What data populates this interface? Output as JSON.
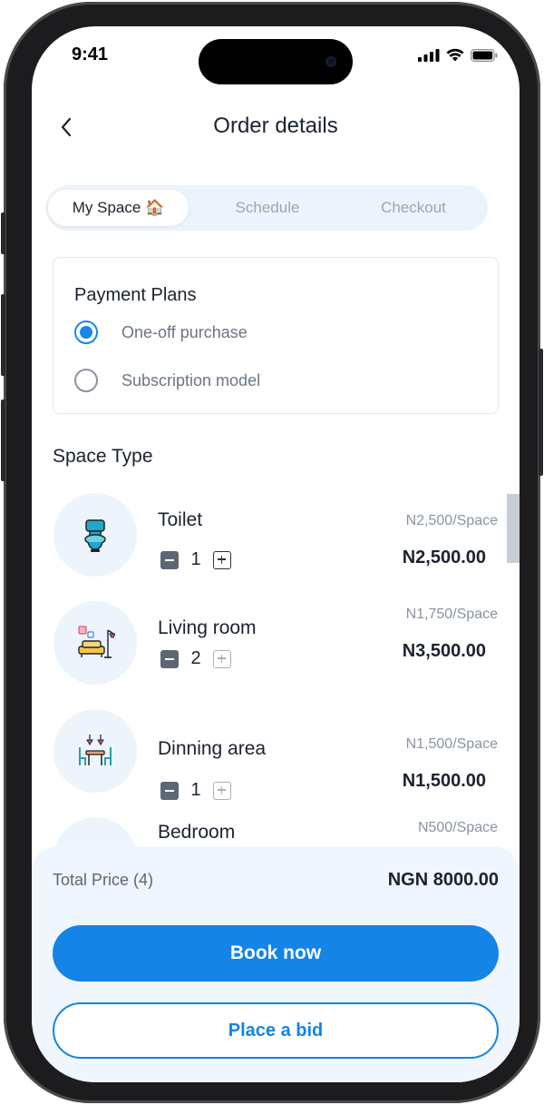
{
  "status_bar": {
    "time": "9:41"
  },
  "header": {
    "title": "Order details",
    "back_icon": "chevron-left-icon"
  },
  "tabs": [
    {
      "label": "My Space 🏠",
      "active": true
    },
    {
      "label": "Schedule",
      "active": false
    },
    {
      "label": "Checkout",
      "active": false
    }
  ],
  "payment_plans": {
    "title": "Payment Plans",
    "options": [
      {
        "label": "One-off purchase",
        "selected": true
      },
      {
        "label": "Subscription model",
        "selected": false
      }
    ]
  },
  "space_type": {
    "title": "Space Type",
    "items": [
      {
        "name": "Toilet",
        "quantity": "1",
        "unit_price": "N2,500/Space",
        "subtotal": "N2,500.00",
        "icon": "toilet-icon"
      },
      {
        "name": "Living room",
        "quantity": "2",
        "unit_price": "N1,750/Space",
        "subtotal": "N3,500.00",
        "icon": "sofa-lamp-icon"
      },
      {
        "name": "Dinning area",
        "quantity": "1",
        "unit_price": "N1,500/Space",
        "subtotal": "N1,500.00",
        "icon": "dining-table-icon"
      },
      {
        "name": "Bedroom",
        "unit_price": "N500/Space",
        "icon": "bed-icon"
      }
    ]
  },
  "footer": {
    "total_label": "Total Price (4)",
    "total_value": "NGN 8000.00",
    "book_label": "Book now",
    "bid_label": "Place a bid"
  },
  "colors": {
    "accent": "#1484e6",
    "text": "#1b2230",
    "muted": "#8a93a0",
    "panel": "#f0f6fe"
  }
}
